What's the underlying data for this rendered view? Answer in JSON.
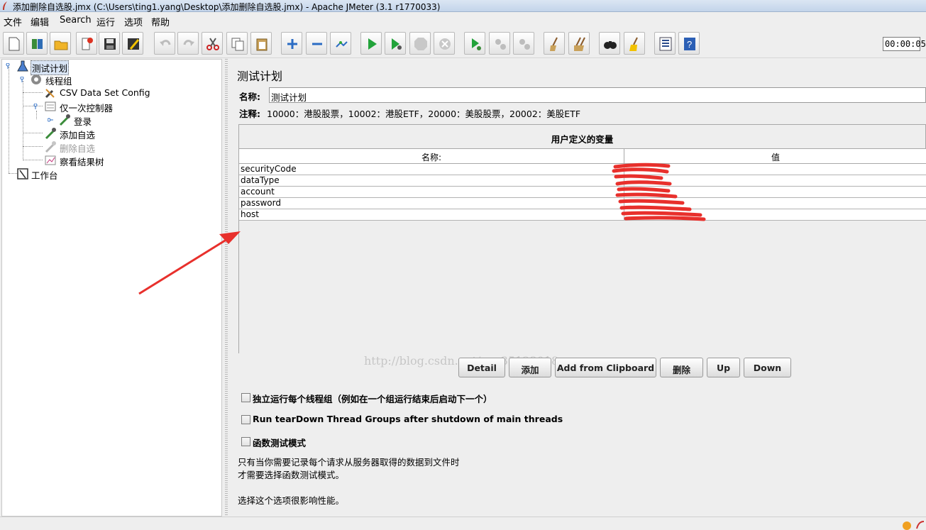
{
  "window": {
    "title": "添加删除自选股.jmx (C:\\Users\\ting1.yang\\Desktop\\添加删除自选股.jmx) - Apache JMeter (3.1 r1770033)"
  },
  "menu": [
    "文件",
    "编辑",
    "Search",
    "运行",
    "选项",
    "帮助"
  ],
  "toolbar": {
    "icons": [
      "new-icon",
      "templates-icon",
      "open-icon",
      "close-icon",
      "save-icon",
      "save-as-icon",
      "undo-icon",
      "redo-icon",
      "cut-icon",
      "copy-icon",
      "paste-icon",
      "expand-icon",
      "collapse-icon",
      "toggle-icon",
      "start-icon",
      "start-no-pause-icon",
      "stop-icon",
      "shutdown-icon",
      "remote-start-icon",
      "remote-stop-icon",
      "remote-exit-icon",
      "clear-icon",
      "clear-all-icon",
      "search-icon",
      "reset-search-icon",
      "function-helper-icon",
      "help-icon"
    ],
    "timer": "00:00:05"
  },
  "tree": {
    "nodes": [
      {
        "label": "测试计划"
      },
      {
        "label": "线程组"
      },
      {
        "label": "CSV Data Set Config"
      },
      {
        "label": "仅一次控制器"
      },
      {
        "label": "登录"
      },
      {
        "label": "添加自选"
      },
      {
        "label": "删除自选"
      },
      {
        "label": "察看结果树"
      },
      {
        "label": "工作台"
      }
    ]
  },
  "panel": {
    "title": "测试计划",
    "name_label": "名称:",
    "name_value": "测试计划",
    "comment_label": "注释:",
    "comment_value": "10000：港股股票，10002：港股ETF，20000：美股股票，20002：美股ETF",
    "vars_title": "用户定义的变量",
    "col_name": "名称:",
    "col_value": "值",
    "rows": [
      {
        "name": "securityCode"
      },
      {
        "name": "dataType"
      },
      {
        "name": "account"
      },
      {
        "name": "password"
      },
      {
        "name": "host"
      }
    ],
    "watermark": "http://blog.csdn.net/qq_35123018",
    "buttons": {
      "detail": "Detail",
      "add": "添加",
      "add_clipboard": "Add from Clipboard",
      "delete": "删除",
      "up": "Up",
      "down": "Down"
    },
    "options": {
      "serialize": "独立运行每个线程组（例如在一个组运行结束后启动下一个）",
      "teardown": "Run tearDown Thread Groups after shutdown of main threads",
      "functional": "函数测试模式"
    },
    "notes": {
      "line1": "只有当你需要记录每个请求从服务器取得的数据到文件时",
      "line2": "才需要选择函数测试模式。",
      "line3": "选择这个选项很影响性能。"
    }
  },
  "colors": {
    "annotation": "#e8302c",
    "redaction": "#e8302c",
    "selection": "#d9e5f5"
  }
}
